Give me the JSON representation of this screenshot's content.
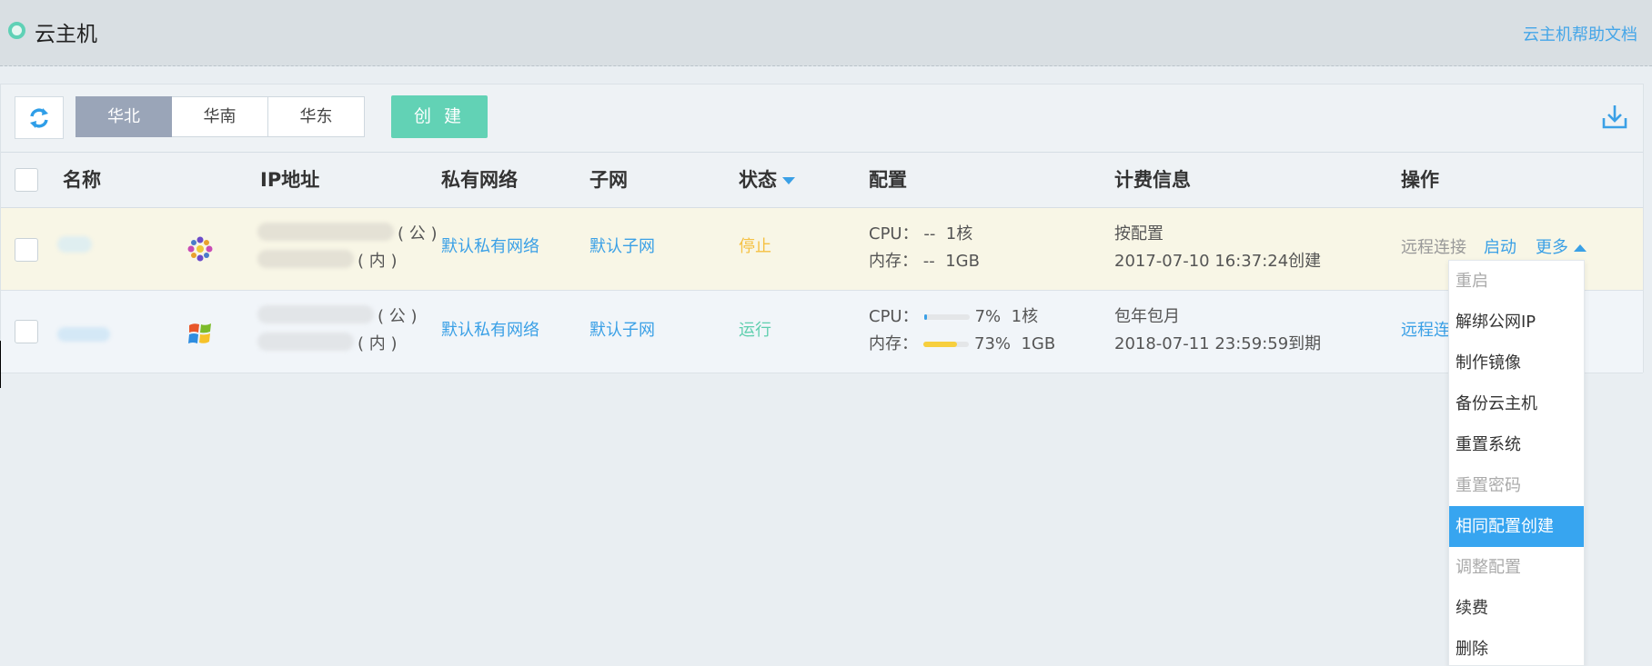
{
  "header": {
    "title": "云主机",
    "help_link": "云主机帮助文档"
  },
  "toolbar": {
    "regions": [
      "华北",
      "华南",
      "华东"
    ],
    "active_region": "华北",
    "create_label": "创 建"
  },
  "table": {
    "columns": {
      "name": "名称",
      "ip": "IP地址",
      "vpc": "私有网络",
      "subnet": "子网",
      "status": "状态",
      "config": "配置",
      "billing": "计费信息",
      "actions": "操作"
    },
    "rows": [
      {
        "os_icon": "cluster-os-icon",
        "public_ip_tag": "( 公 )",
        "private_ip_tag": "( 内 )",
        "vpc": "默认私有网络",
        "subnet": "默认子网",
        "status": "停止",
        "cpu_label": "CPU：",
        "cpu_value": "--",
        "cpu_cores": "1核",
        "mem_label": "内存：",
        "mem_value": "--",
        "mem_size": "1GB",
        "billing_type": "按配置",
        "billing_time": "2017-07-10 16:37:24创建",
        "action_remote": "远程连接",
        "action_start": "启动",
        "action_more": "更多"
      },
      {
        "os_icon": "windows-logo-icon",
        "public_ip_tag": "( 公 )",
        "private_ip_tag": "( 内 )",
        "vpc": "默认私有网络",
        "subnet": "默认子网",
        "status": "运行",
        "cpu_label": "CPU：",
        "cpu_percent": 7,
        "cpu_value": "7%",
        "cpu_cores": "1核",
        "mem_label": "内存：",
        "mem_percent": 73,
        "mem_value": "73%",
        "mem_size": "1GB",
        "billing_type": "包年包月",
        "billing_time": "2018-07-11 23:59:59到期",
        "action_remote": "远程连"
      }
    ]
  },
  "more_menu": {
    "items": [
      {
        "label": "重启",
        "state": "disabled"
      },
      {
        "label": "解绑公网IP",
        "state": "normal"
      },
      {
        "label": "制作镜像",
        "state": "normal"
      },
      {
        "label": "备份云主机",
        "state": "normal"
      },
      {
        "label": "重置系统",
        "state": "normal"
      },
      {
        "label": "重置密码",
        "state": "disabled"
      },
      {
        "label": "相同配置创建",
        "state": "highlight"
      },
      {
        "label": "调整配置",
        "state": "disabled"
      },
      {
        "label": "续费",
        "state": "normal"
      },
      {
        "label": "删除",
        "state": "normal"
      }
    ]
  },
  "colors": {
    "accent_blue": "#3aa0e6",
    "create_green": "#62d2b5",
    "status_stop": "#f5c143",
    "status_run": "#5fcfae",
    "menu_highlight": "#37a5f0",
    "cpu_bar": "#3aa0e6",
    "mem_bar": "#f7cf3e"
  }
}
